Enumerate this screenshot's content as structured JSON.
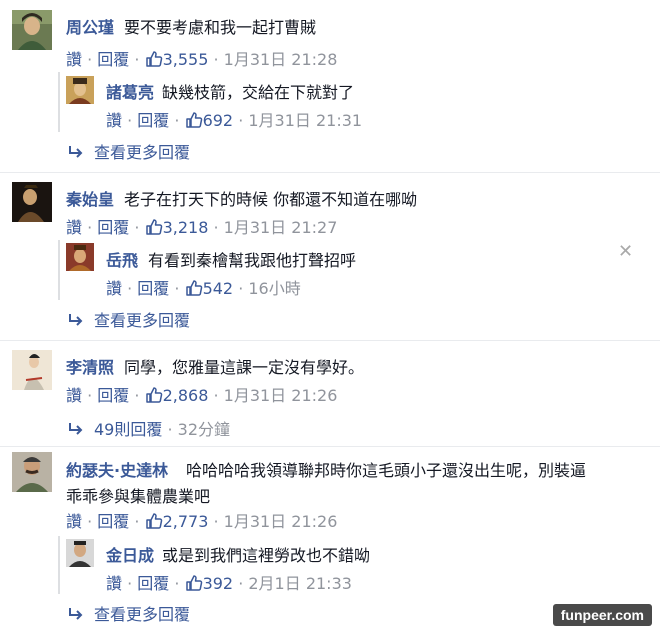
{
  "actions": {
    "like": "讚",
    "reply": "回覆",
    "dot": " · "
  },
  "threads": [
    {
      "name": "周公瑾",
      "text": "要不要考慮和我一起打曹賊",
      "likes": "3,555",
      "time": "1月31日 21:28",
      "reply": {
        "name": "諸葛亮",
        "text": "缺幾枝箭，交給在下就對了",
        "likes": "692",
        "time": "1月31日 21:31"
      },
      "more": "查看更多回覆"
    },
    {
      "name": "秦始皇",
      "text": "老子在打天下的時候 你都還不知道在哪呦",
      "likes": "3,218",
      "time": "1月31日 21:27",
      "reply": {
        "name": "岳飛",
        "text": "有看到秦檜幫我跟他打聲招呼",
        "likes": "542",
        "time": "16小時"
      },
      "more": "查看更多回覆"
    },
    {
      "name": "李清照",
      "text": "同學，您雅量這課一定沒有學好。",
      "likes": "2,868",
      "time": "1月31日 21:26",
      "more_count": "49則回覆",
      "more_time": "32分鐘"
    },
    {
      "name": "約瑟夫·史達林",
      "text_line1": "哈哈哈哈我領導聯邦時你這毛頭小子還沒出生呢，別裝逼",
      "text_line2": "乖乖參與集體農業吧",
      "likes": "2,773",
      "time": "1月31日 21:26",
      "reply": {
        "name": "金日成",
        "text": "或是到我們這裡勞改也不錯呦",
        "likes": "392",
        "time": "2月1日 21:33"
      },
      "more": "查看更多回覆"
    }
  ],
  "watermark": "funpeer.com",
  "icons": [
    "thumbs-up-icon",
    "reply-arrow-icon",
    "close-icon"
  ],
  "colors": {
    "link": "#3b5998",
    "muted": "#90949c",
    "text": "#141823"
  }
}
